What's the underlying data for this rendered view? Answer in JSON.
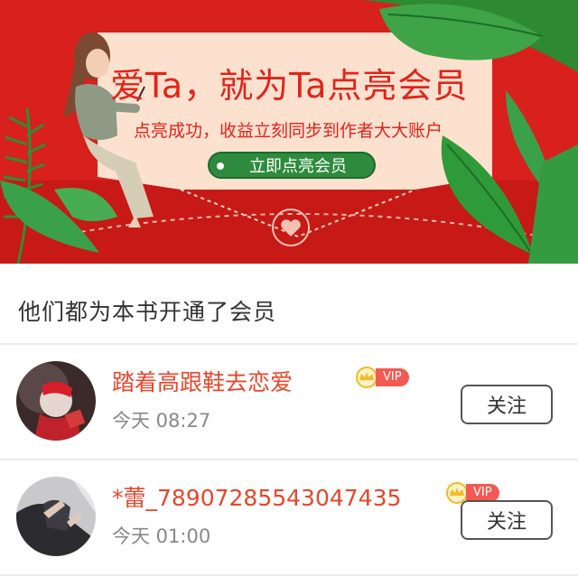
{
  "banner": {
    "headline": "爱Ta，就为Ta点亮会员",
    "subtitle": "点亮成功，收益立刻同步到作者大大账户",
    "cta_label": "立即点亮会员"
  },
  "section": {
    "title": "他们都为本书开通了会员"
  },
  "members": [
    {
      "name": "踏着高跟鞋去恋爱",
      "badge": "VIP",
      "time": "今天 08:27",
      "follow_label": "关注"
    },
    {
      "name": "*蕾_78907285543047435",
      "badge": "VIP",
      "time": "今天 01:00",
      "follow_label": "关注"
    }
  ],
  "colors": {
    "banner_red": "#d8201c",
    "name_red": "#e8462b",
    "cta_green": "#2e8b3d",
    "vip_red": "#f25a52",
    "crown_gold": "#f5b921"
  },
  "icons": [
    "crown-icon",
    "heart-emblem-icon"
  ]
}
